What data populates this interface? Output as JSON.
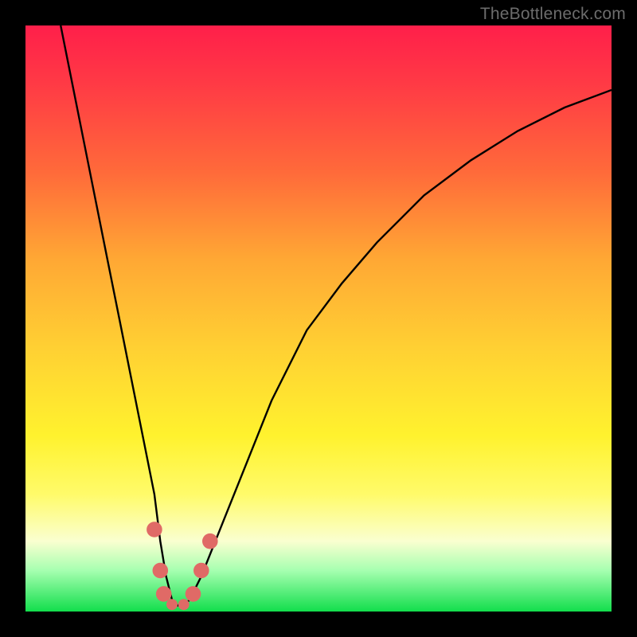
{
  "watermark": "TheBottleneck.com",
  "chart_data": {
    "type": "line",
    "title": "",
    "xlabel": "",
    "ylabel": "",
    "xlim": [
      0,
      100
    ],
    "ylim": [
      0,
      100
    ],
    "series": [
      {
        "name": "bottleneck-curve",
        "x": [
          6,
          8,
          10,
          12,
          14,
          16,
          18,
          20,
          22,
          23,
          24,
          25,
          26,
          27,
          28,
          30,
          34,
          38,
          42,
          48,
          54,
          60,
          68,
          76,
          84,
          92,
          100
        ],
        "y": [
          100,
          90,
          80,
          70,
          60,
          50,
          40,
          30,
          20,
          12,
          6,
          2,
          1,
          1,
          2,
          6,
          16,
          26,
          36,
          48,
          56,
          63,
          71,
          77,
          82,
          86,
          89
        ]
      }
    ],
    "markers": [
      {
        "name": "left-dot-upper",
        "x": 22.0,
        "y": 14.0,
        "r": 1.4
      },
      {
        "name": "left-dot-mid",
        "x": 23.0,
        "y": 7.0,
        "r": 1.4
      },
      {
        "name": "left-dot-low",
        "x": 23.6,
        "y": 3.0,
        "r": 1.4
      },
      {
        "name": "valley-dot-1",
        "x": 25.0,
        "y": 1.2,
        "r": 1.0
      },
      {
        "name": "valley-dot-2",
        "x": 27.0,
        "y": 1.2,
        "r": 1.0
      },
      {
        "name": "right-dot-low",
        "x": 28.6,
        "y": 3.0,
        "r": 1.4
      },
      {
        "name": "right-dot-mid",
        "x": 30.0,
        "y": 7.0,
        "r": 1.4
      },
      {
        "name": "right-dot-upper",
        "x": 31.5,
        "y": 12.0,
        "r": 1.4
      }
    ],
    "colors": {
      "curve": "#000000",
      "marker": "#e06a66"
    }
  }
}
